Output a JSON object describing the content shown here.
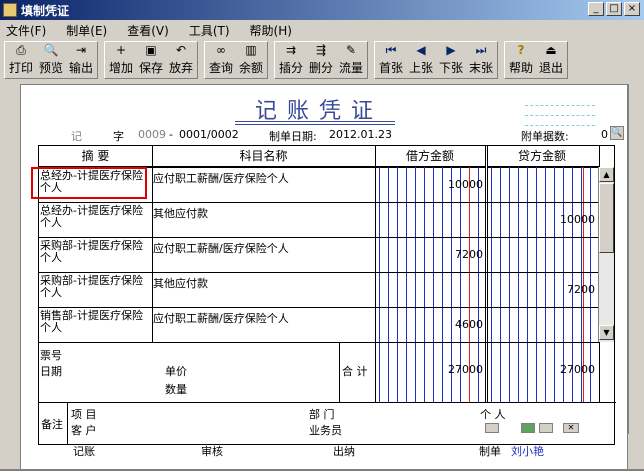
{
  "window": {
    "title": "填制凭证",
    "min": "_",
    "max": "□",
    "close": "×"
  },
  "menu": [
    {
      "label": "文件(F)"
    },
    {
      "label": "制单(E)"
    },
    {
      "label": "查看(V)"
    },
    {
      "label": "工具(T)"
    },
    {
      "label": "帮助(H)"
    }
  ],
  "toolbar": [
    {
      "label": "打印",
      "icon": "printer-icon",
      "glyph": "⎙"
    },
    {
      "label": "预览",
      "icon": "preview-icon",
      "glyph": "🔍"
    },
    {
      "label": "输出",
      "icon": "export-icon",
      "glyph": "⇥"
    },
    {
      "label": "增加",
      "icon": "add-icon",
      "glyph": "+"
    },
    {
      "label": "保存",
      "icon": "save-icon",
      "glyph": "▣"
    },
    {
      "label": "放弃",
      "icon": "undo-icon",
      "glyph": "↶"
    },
    {
      "label": "查询",
      "icon": "binoculars-icon",
      "glyph": "∞"
    },
    {
      "label": "余额",
      "icon": "bar-chart-icon",
      "glyph": "▥"
    },
    {
      "label": "插分",
      "icon": "insert-row-icon",
      "glyph": "⇉"
    },
    {
      "label": "删分",
      "icon": "delete-row-icon",
      "glyph": "⇶"
    },
    {
      "label": "流量",
      "icon": "flow-icon",
      "glyph": "✎"
    },
    {
      "label": "首张",
      "icon": "first-icon",
      "glyph": "⏮"
    },
    {
      "label": "上张",
      "icon": "prev-icon",
      "glyph": "◀"
    },
    {
      "label": "下张",
      "icon": "next-icon",
      "glyph": "▶"
    },
    {
      "label": "末张",
      "icon": "last-icon",
      "glyph": "⏭"
    },
    {
      "label": "帮助",
      "icon": "help-icon",
      "glyph": "?"
    },
    {
      "label": "退出",
      "icon": "exit-icon",
      "glyph": "⏏"
    }
  ],
  "voucher": {
    "title": "记账凭证",
    "type": "记",
    "type_suffix": "字",
    "code": "0009",
    "dash": "-",
    "number": "0001/0002",
    "date_label": "制单日期:",
    "date": "2012.01.23",
    "attach_label": "附单据数:",
    "attach_count": "0",
    "headers": {
      "summary": "摘 要",
      "account": "科目名称",
      "debit": "借方金额",
      "credit": "贷方金额"
    },
    "rows": [
      {
        "summary": "总经办-计提医疗保险个人",
        "account": "应付职工薪酬/医疗保险个人",
        "debit": "10000",
        "credit": ""
      },
      {
        "summary": "总经办-计提医疗保险个人",
        "account": "其他应付款",
        "debit": "",
        "credit": "10000"
      },
      {
        "summary": "采购部-计提医疗保险个人",
        "account": "应付职工薪酬/医疗保险个人",
        "debit": "7200",
        "credit": ""
      },
      {
        "summary": "采购部-计提医疗保险个人",
        "account": "其他应付款",
        "debit": "",
        "credit": "7200"
      },
      {
        "summary": "销售部-计提医疗保险个人",
        "account": "应付职工薪酬/医疗保险个人",
        "debit": "4600",
        "credit": ""
      }
    ],
    "info": {
      "ticket_label": "票号",
      "date_label": "日期",
      "price_label": "单价",
      "qty_label": "数量",
      "total_label": "合 计",
      "total_debit": "27000",
      "total_credit": "27000"
    },
    "remarks": {
      "label": "备注",
      "project_label": "项 目",
      "customer_label": "客 户",
      "dept_label": "部 门",
      "staff_label": "业务员",
      "person_label": "个 人"
    },
    "footer": {
      "book_label": "记账",
      "audit_label": "审核",
      "cashier_label": "出纳",
      "maker_label": "制单",
      "maker_name": "刘小艳"
    }
  }
}
